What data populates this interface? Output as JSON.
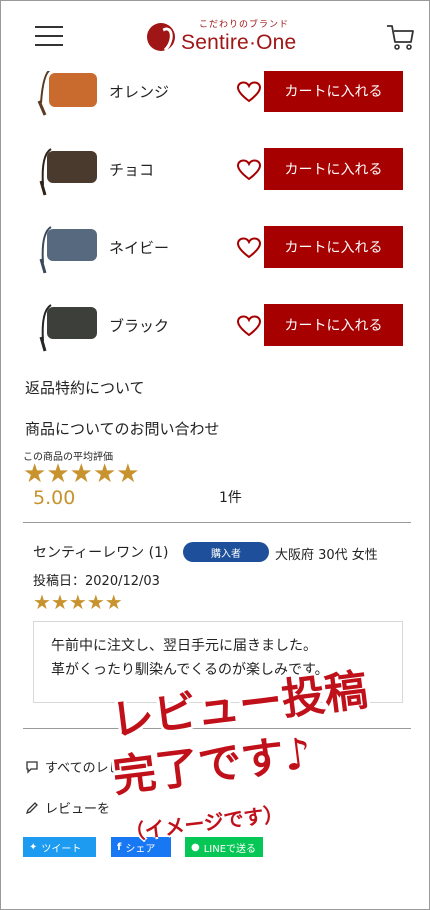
{
  "header": {
    "logo_tagline": "こだわりのブランド",
    "logo_name": "Sentire·One"
  },
  "variants": [
    {
      "name": "オレンジ",
      "color": "#c96a2e",
      "cart_label": "カートに入れる"
    },
    {
      "name": "チョコ",
      "color": "#4a3a2e",
      "cart_label": "カートに入れる"
    },
    {
      "name": "ネイビー",
      "color": "#56697f",
      "cart_label": "カートに入れる"
    },
    {
      "name": "ブラック",
      "color": "#3d3f3b",
      "cart_label": "カートに入れる"
    }
  ],
  "links": {
    "return_policy": "返品特約について",
    "inquiry": "商品についてのお問い合わせ"
  },
  "rating": {
    "label": "この商品の平均評価",
    "average": "5.00",
    "stars": 5,
    "count": "1件"
  },
  "review": {
    "reviewer": "センティーレワン (1)",
    "badge": "購入者",
    "meta": "大阪府 30代 女性",
    "date": "投稿日：2020/12/03",
    "stars": 5,
    "line1": "午前中に注文し、翌日手元に届きました。",
    "line2": "革がくったり馴染んでくるのが楽しみです。"
  },
  "bottom": {
    "all_reviews": "すべてのレビュー",
    "write_review": "レビューを",
    "share_twitter": "ツイート",
    "share_facebook": "シェア",
    "share_line": "LINEで送る"
  },
  "overlay": {
    "line1": "レビュー投稿",
    "line2": "完了です♪",
    "line3": "（イメージです）"
  },
  "colors": {
    "brand_red": "#a60000",
    "star_gold": "#c8932e",
    "badge_blue": "#1e4f9a"
  }
}
